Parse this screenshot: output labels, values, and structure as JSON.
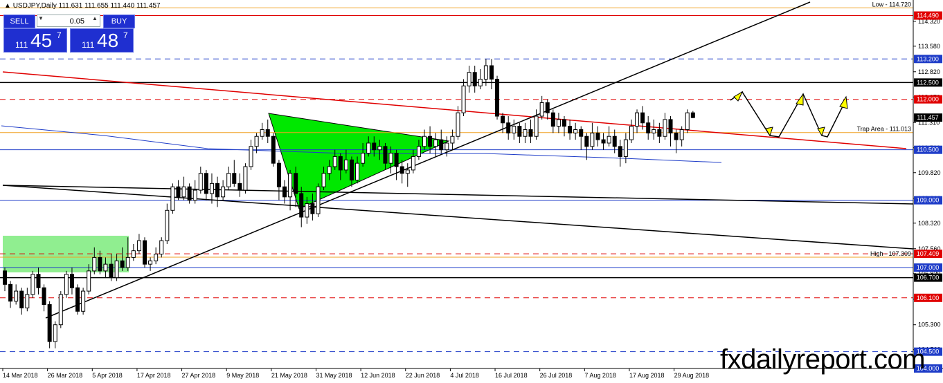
{
  "header": {
    "symbol_line": "USDJPY,Daily  111.631 111.655 111.440 111.457"
  },
  "trade_panel": {
    "sell_label": "SELL",
    "buy_label": "BUY",
    "lot_value": "0.05",
    "sell_prefix": "111",
    "sell_big": "45",
    "sell_sup": "7",
    "buy_prefix": "111",
    "buy_big": "48",
    "buy_sup": "7"
  },
  "watermark": "fxdailyreport.com",
  "chart_data": {
    "type": "candlestick",
    "price_axis": {
      "ylim": [
        104.0,
        114.85
      ],
      "tick_labels": [
        "114.320",
        "113.580",
        "112.820",
        "112.070",
        "111.310",
        "110.560",
        "109.820",
        "109.060",
        "108.320",
        "107.560",
        "106.820",
        "106.060",
        "105.300",
        "104.560",
        "103.810"
      ],
      "tick_values": [
        114.32,
        113.58,
        112.82,
        112.07,
        111.31,
        110.56,
        109.82,
        109.06,
        108.32,
        107.56,
        106.82,
        106.06,
        105.3,
        104.56,
        103.81
      ]
    },
    "date_axis": {
      "labels": [
        "14 Mar 2018",
        "26 Mar 2018",
        "5 Apr 2018",
        "17 Apr 2018",
        "27 Apr 2018",
        "9 May 2018",
        "21 May 2018",
        "31 May 2018",
        "12 Jun 2018",
        "22 Jun 2018",
        "4 Jul 2018",
        "16 Jul 2018",
        "26 Jul 2018",
        "7 Aug 2018",
        "17 Aug 2018",
        "29 Aug 2018"
      ],
      "bar_index": [
        0,
        8,
        16,
        24,
        32,
        40,
        48,
        56,
        64,
        72,
        80,
        88,
        96,
        104,
        112,
        120
      ]
    },
    "price_labels": [
      {
        "text": "114.490",
        "value": 114.49,
        "color": "#e00000"
      },
      {
        "text": "113.200",
        "value": 113.2,
        "color": "#1e3cc8"
      },
      {
        "text": "112.500",
        "value": 112.5,
        "color": "#000000"
      },
      {
        "text": "112.000",
        "value": 112.0,
        "color": "#e00000"
      },
      {
        "text": "111.457",
        "value": 111.457,
        "color": "#000000"
      },
      {
        "text": "110.500",
        "value": 110.5,
        "color": "#1e3cc8"
      },
      {
        "text": "109.000",
        "value": 109.0,
        "color": "#1e3cc8"
      },
      {
        "text": "107.409",
        "value": 107.409,
        "color": "#e00000"
      },
      {
        "text": "107.000",
        "value": 107.0,
        "color": "#1e3cc8"
      },
      {
        "text": "106.700",
        "value": 106.7,
        "color": "#000000"
      },
      {
        "text": "106.100",
        "value": 106.1,
        "color": "#e00000"
      },
      {
        "text": "104.500",
        "value": 104.5,
        "color": "#1e3cc8"
      },
      {
        "text": "104.000",
        "value": 104.0,
        "color": "#1e3cc8"
      }
    ],
    "annotations": [
      {
        "text": "Low - 114.720",
        "value": 114.72,
        "color": "#e0a020"
      },
      {
        "text": "Trap Area - 111.013",
        "value": 111.013,
        "color": "#e0a020"
      },
      {
        "text": "High - 107.309",
        "value": 107.309,
        "color": "#e0a020"
      }
    ],
    "levels": [
      {
        "value": 114.72,
        "color": "#f0a020",
        "style": "solid"
      },
      {
        "value": 114.49,
        "color": "#e00000",
        "style": "solid"
      },
      {
        "value": 113.2,
        "color": "#1e3cc8",
        "style": "dash"
      },
      {
        "value": 112.5,
        "color": "#000000",
        "style": "solid"
      },
      {
        "value": 112.0,
        "color": "#e00000",
        "style": "dash"
      },
      {
        "value": 111.013,
        "color": "#f0a020",
        "style": "solid"
      },
      {
        "value": 110.5,
        "color": "#1e3cc8",
        "style": "solid"
      },
      {
        "value": 109.0,
        "color": "#1e3cc8",
        "style": "solid"
      },
      {
        "value": 107.409,
        "color": "#e00000",
        "style": "dash"
      },
      {
        "value": 107.309,
        "color": "#f0a020",
        "style": "solid"
      },
      {
        "value": 107.0,
        "color": "#1e3cc8",
        "style": "solid"
      },
      {
        "value": 106.7,
        "color": "#000000",
        "style": "solid"
      },
      {
        "value": 106.1,
        "color": "#e00000",
        "style": "dash"
      },
      {
        "value": 104.5,
        "color": "#1e3cc8",
        "style": "dash"
      },
      {
        "value": 104.0,
        "color": "#e00000",
        "style": "dash"
      }
    ],
    "candles": [
      [
        106.9,
        106.5,
        107.0,
        106.3
      ],
      [
        106.5,
        106.0,
        106.6,
        105.8
      ],
      [
        106.0,
        106.3,
        106.5,
        105.9
      ],
      [
        106.3,
        105.8,
        106.4,
        105.6
      ],
      [
        105.8,
        106.2,
        106.4,
        105.7
      ],
      [
        106.2,
        106.8,
        106.9,
        106.1
      ],
      [
        106.8,
        106.4,
        107.0,
        106.2
      ],
      [
        106.4,
        105.9,
        106.5,
        105.7
      ],
      [
        105.9,
        104.8,
        106.0,
        104.6
      ],
      [
        104.8,
        105.3,
        105.4,
        104.6
      ],
      [
        105.3,
        106.2,
        106.3,
        105.2
      ],
      [
        106.2,
        106.8,
        106.9,
        106.1
      ],
      [
        106.8,
        106.4,
        107.0,
        106.2
      ],
      [
        106.4,
        105.7,
        106.5,
        105.6
      ],
      [
        105.7,
        106.3,
        106.4,
        105.6
      ],
      [
        106.3,
        106.9,
        107.1,
        106.2
      ],
      [
        106.9,
        107.3,
        107.6,
        106.8
      ],
      [
        107.3,
        106.9,
        107.5,
        106.8
      ],
      [
        106.9,
        107.1,
        107.3,
        106.7
      ],
      [
        107.1,
        106.7,
        107.4,
        106.6
      ],
      [
        106.7,
        107.2,
        107.4,
        106.6
      ],
      [
        107.2,
        107.0,
        107.6,
        106.9
      ],
      [
        107.0,
        107.3,
        107.9,
        106.9
      ],
      [
        107.3,
        107.5,
        107.7,
        107.2
      ],
      [
        107.5,
        107.8,
        108.0,
        107.4
      ],
      [
        107.8,
        107.1,
        107.9,
        107.0
      ],
      [
        107.1,
        107.2,
        107.3,
        106.9
      ],
      [
        107.2,
        107.4,
        107.6,
        107.1
      ],
      [
        107.4,
        107.8,
        107.9,
        107.3
      ],
      [
        107.8,
        108.7,
        108.9,
        107.7
      ],
      [
        108.7,
        109.4,
        109.5,
        108.6
      ],
      [
        109.4,
        109.1,
        109.6,
        109.0
      ],
      [
        109.1,
        109.4,
        109.7,
        109.0
      ],
      [
        109.4,
        109.0,
        109.5,
        108.9
      ],
      [
        109.0,
        109.3,
        109.6,
        108.9
      ],
      [
        109.3,
        109.8,
        110.0,
        109.2
      ],
      [
        109.8,
        109.2,
        109.9,
        109.0
      ],
      [
        109.2,
        109.5,
        109.8,
        108.9
      ],
      [
        109.5,
        109.1,
        109.7,
        108.8
      ],
      [
        109.1,
        109.4,
        109.6,
        109.0
      ],
      [
        109.4,
        109.8,
        110.0,
        109.3
      ],
      [
        109.8,
        109.5,
        110.2,
        109.4
      ],
      [
        109.5,
        109.3,
        109.8,
        109.1
      ],
      [
        109.3,
        110.0,
        110.1,
        109.2
      ],
      [
        110.0,
        110.6,
        110.8,
        109.9
      ],
      [
        110.6,
        110.9,
        111.0,
        110.4
      ],
      [
        110.9,
        111.1,
        111.3,
        110.8
      ],
      [
        111.1,
        110.9,
        111.4,
        110.7
      ],
      [
        110.9,
        110.1,
        111.0,
        110.0
      ],
      [
        110.1,
        109.4,
        110.2,
        109.0
      ],
      [
        109.4,
        109.1,
        109.6,
        108.9
      ],
      [
        109.1,
        109.8,
        109.9,
        108.7
      ],
      [
        109.8,
        109.2,
        110.0,
        108.8
      ],
      [
        109.2,
        108.5,
        109.4,
        108.2
      ],
      [
        108.5,
        108.9,
        109.1,
        108.3
      ],
      [
        108.9,
        108.6,
        109.2,
        108.4
      ],
      [
        108.6,
        109.4,
        109.5,
        108.5
      ],
      [
        109.4,
        109.8,
        110.0,
        109.3
      ],
      [
        109.8,
        110.0,
        110.2,
        109.6
      ],
      [
        110.0,
        110.3,
        110.5,
        109.9
      ],
      [
        110.3,
        109.9,
        110.4,
        109.6
      ],
      [
        109.9,
        110.2,
        110.5,
        109.8
      ],
      [
        110.2,
        109.6,
        110.3,
        109.4
      ],
      [
        109.6,
        110.1,
        110.3,
        109.5
      ],
      [
        110.1,
        110.4,
        110.7,
        110.0
      ],
      [
        110.4,
        110.7,
        110.9,
        110.3
      ],
      [
        110.7,
        110.5,
        110.9,
        110.3
      ],
      [
        110.5,
        110.6,
        110.8,
        110.2
      ],
      [
        110.6,
        110.1,
        110.7,
        109.9
      ],
      [
        110.1,
        110.4,
        110.6,
        109.8
      ],
      [
        110.4,
        110.0,
        110.5,
        109.6
      ],
      [
        110.0,
        109.8,
        110.2,
        109.5
      ],
      [
        109.8,
        109.9,
        110.1,
        109.4
      ],
      [
        109.9,
        110.3,
        110.5,
        109.8
      ],
      [
        110.3,
        110.6,
        110.8,
        110.2
      ],
      [
        110.6,
        110.9,
        111.1,
        110.5
      ],
      [
        110.9,
        110.6,
        111.2,
        110.4
      ],
      [
        110.6,
        110.8,
        111.0,
        110.3
      ],
      [
        110.8,
        110.5,
        111.1,
        110.4
      ],
      [
        110.5,
        110.7,
        110.9,
        110.3
      ],
      [
        110.7,
        110.9,
        111.1,
        110.5
      ],
      [
        110.9,
        111.6,
        111.8,
        110.8
      ],
      [
        111.6,
        112.4,
        112.6,
        111.5
      ],
      [
        112.4,
        112.8,
        113.0,
        112.2
      ],
      [
        112.8,
        112.4,
        113.0,
        112.2
      ],
      [
        112.4,
        112.6,
        112.9,
        112.3
      ],
      [
        112.6,
        113.0,
        113.2,
        112.4
      ],
      [
        113.0,
        112.6,
        113.2,
        112.3
      ],
      [
        112.6,
        111.5,
        112.7,
        111.4
      ],
      [
        111.5,
        111.3,
        111.6,
        111.0
      ],
      [
        111.3,
        111.0,
        111.5,
        110.8
      ],
      [
        111.0,
        111.2,
        111.4,
        110.8
      ],
      [
        111.2,
        110.9,
        111.3,
        110.7
      ],
      [
        110.9,
        111.1,
        111.3,
        110.7
      ],
      [
        111.1,
        110.9,
        111.4,
        110.7
      ],
      [
        110.9,
        111.5,
        111.7,
        110.8
      ],
      [
        111.5,
        111.9,
        112.1,
        111.4
      ],
      [
        111.9,
        111.6,
        112.0,
        111.4
      ],
      [
        111.6,
        111.2,
        111.7,
        111.0
      ],
      [
        111.2,
        111.4,
        111.6,
        111.0
      ],
      [
        111.4,
        111.2,
        111.5,
        110.9
      ],
      [
        111.2,
        111.0,
        111.4,
        110.8
      ],
      [
        111.0,
        111.1,
        111.3,
        110.8
      ],
      [
        111.1,
        110.9,
        111.2,
        110.5
      ],
      [
        110.9,
        110.6,
        111.0,
        110.2
      ],
      [
        110.6,
        111.0,
        111.3,
        110.5
      ],
      [
        111.0,
        110.8,
        111.2,
        110.6
      ],
      [
        110.8,
        110.7,
        111.0,
        110.5
      ],
      [
        110.7,
        110.9,
        111.2,
        110.6
      ],
      [
        110.9,
        110.6,
        111.1,
        110.4
      ],
      [
        110.6,
        110.3,
        110.8,
        110.0
      ],
      [
        110.3,
        110.8,
        111.0,
        110.1
      ],
      [
        110.8,
        111.2,
        111.4,
        110.7
      ],
      [
        111.2,
        111.6,
        111.7,
        111.0
      ],
      [
        111.6,
        111.3,
        111.8,
        111.1
      ],
      [
        111.3,
        111.0,
        111.5,
        110.8
      ],
      [
        111.0,
        111.1,
        111.4,
        110.8
      ],
      [
        111.1,
        110.9,
        111.3,
        110.7
      ],
      [
        110.9,
        111.4,
        111.6,
        110.8
      ],
      [
        111.4,
        111.0,
        111.5,
        110.6
      ],
      [
        111.0,
        110.8,
        111.1,
        110.4
      ],
      [
        110.8,
        111.1,
        111.2,
        110.6
      ],
      [
        111.1,
        111.6,
        111.7,
        111.0
      ],
      [
        111.6,
        111.457,
        111.655,
        111.44
      ]
    ]
  }
}
